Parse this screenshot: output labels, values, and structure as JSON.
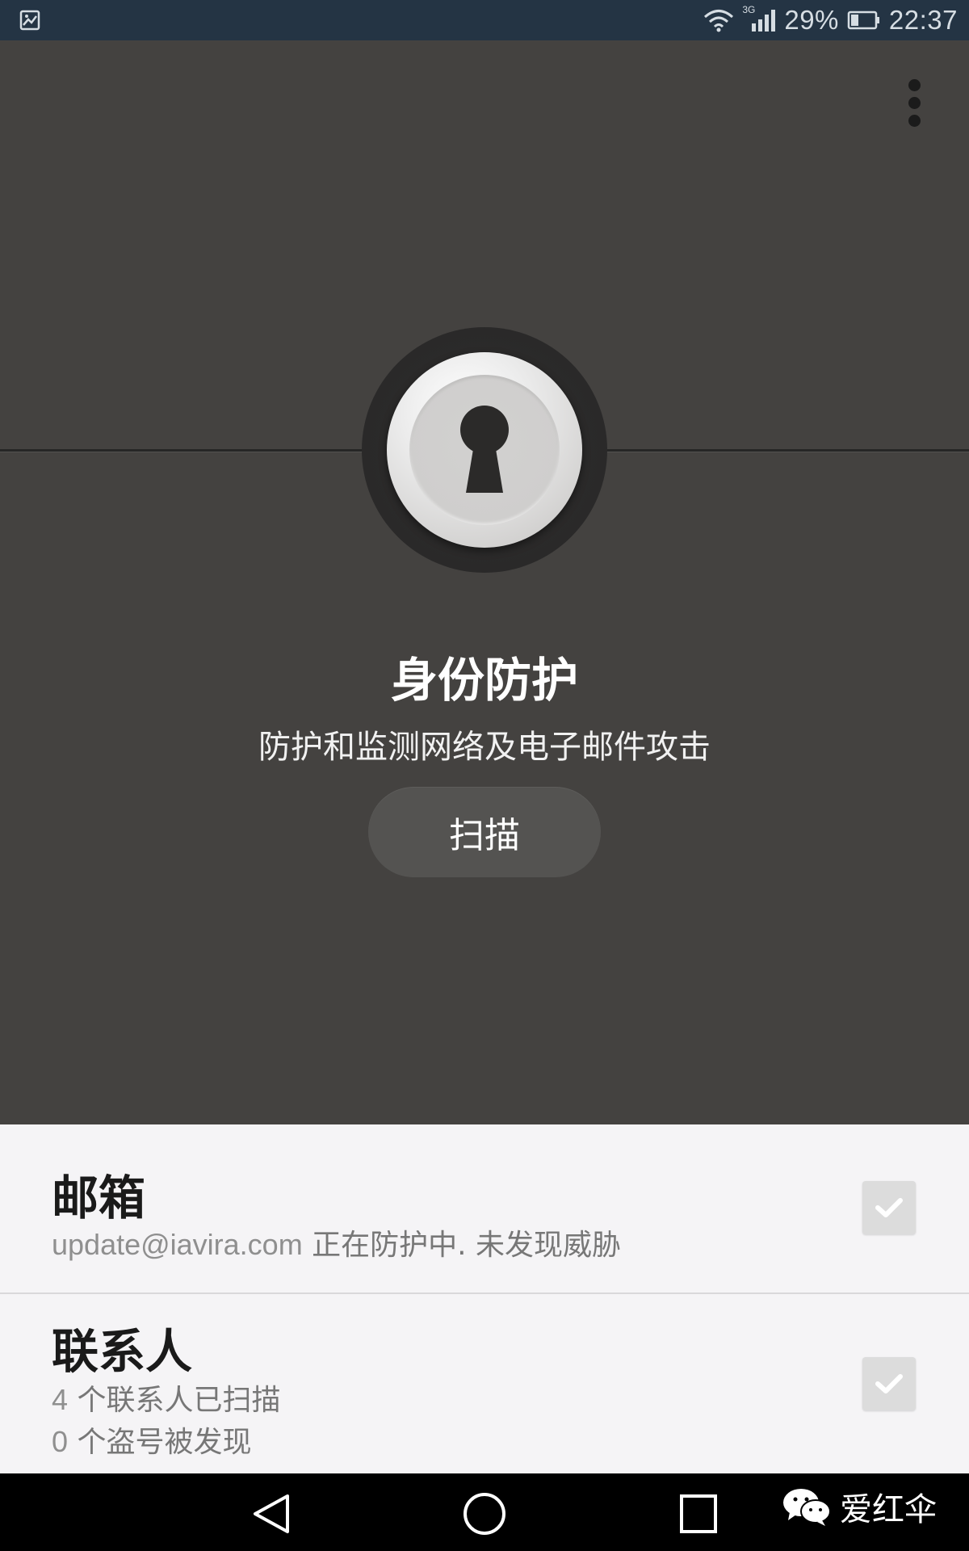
{
  "status_bar": {
    "network_type": "3G",
    "battery": "29%",
    "time": "22:37",
    "icons": [
      "image-notification-icon",
      "wifi-icon",
      "signal-icon",
      "battery-icon"
    ]
  },
  "header": {
    "menu_icon": "more-vert-icon"
  },
  "hero": {
    "icon": "lock-keyhole-icon",
    "title": "身份防护",
    "subtitle": "防护和监测网络及电子邮件攻击",
    "scan_label": "扫描"
  },
  "list": {
    "items": [
      {
        "title": "邮箱",
        "email": "update@iavira.com",
        "status": " 正在防护中. 未发现威胁",
        "checked": true
      },
      {
        "title": "联系人",
        "scanned_count": "4",
        "scanned_text": " 个联系人已扫描",
        "found_count": "0",
        "found_text": " 个盗号被发现",
        "checked": true
      }
    ]
  },
  "nav_bar": {
    "buttons": [
      "back-icon",
      "home-icon",
      "recents-icon"
    ],
    "watermark": "爱红伞"
  },
  "colors": {
    "background": "#444240",
    "status_bar": "#243444",
    "list_background": "#f5f4f6"
  }
}
